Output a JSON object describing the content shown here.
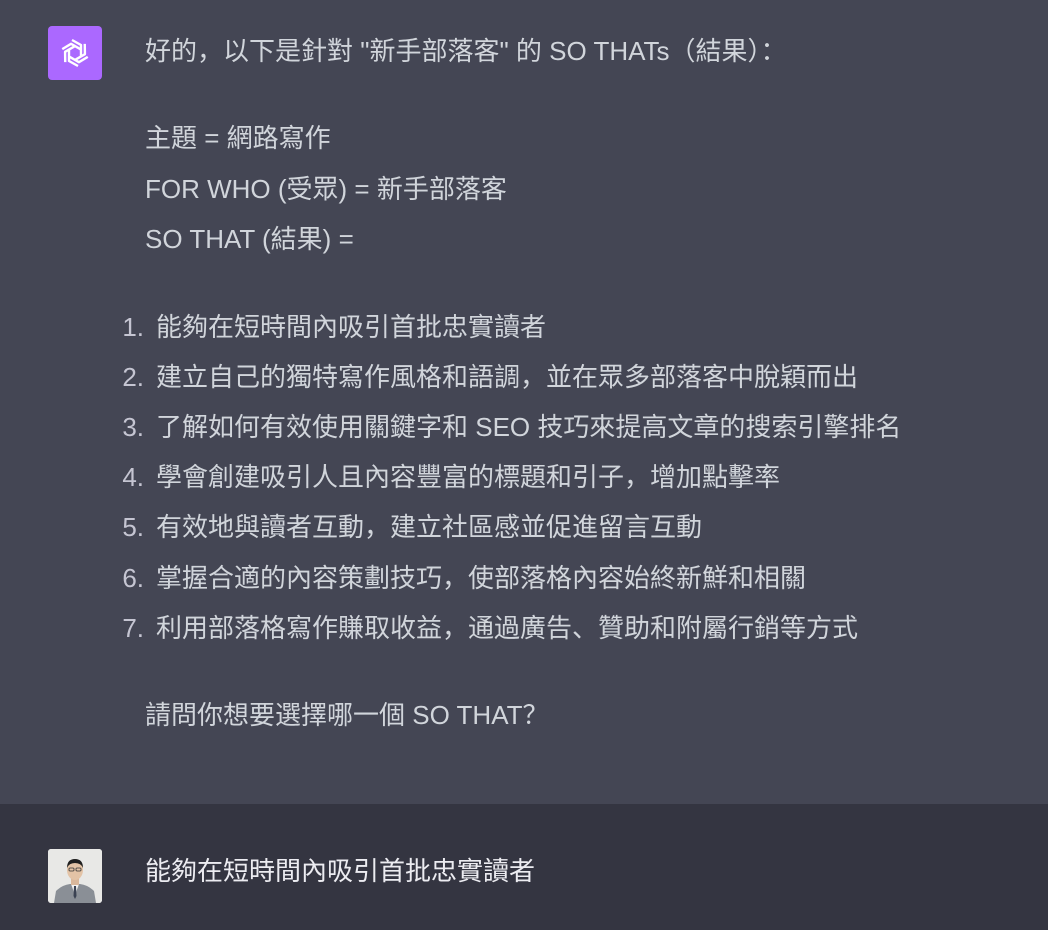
{
  "assistant": {
    "avatar_icon": "openai-logo-icon",
    "avatar_color": "#ab68ff",
    "intro": "好的，以下是針對 \"新手部落客\" 的 SO THATs（結果）：",
    "topic_line": "主題 = 網路寫作",
    "for_who_line": "FOR WHO (受眾) = 新手部落客",
    "so_that_line": "SO THAT (結果) =",
    "items": [
      {
        "num": "1.",
        "text": "能夠在短時間內吸引首批忠實讀者"
      },
      {
        "num": "2.",
        "text": "建立自己的獨特寫作風格和語調，並在眾多部落客中脫穎而出"
      },
      {
        "num": "3.",
        "text": "了解如何有效使用關鍵字和 SEO 技巧來提高文章的搜索引擎排名"
      },
      {
        "num": "4.",
        "text": "學會創建吸引人且內容豐富的標題和引子，增加點擊率"
      },
      {
        "num": "5.",
        "text": "有效地與讀者互動，建立社區感並促進留言互動"
      },
      {
        "num": "6.",
        "text": "掌握合適的內容策劃技巧，使部落格內容始終新鮮和相關"
      },
      {
        "num": "7.",
        "text": "利用部落格寫作賺取收益，通過廣告、贊助和附屬行銷等方式"
      }
    ],
    "question": "請問你想要選擇哪一個 SO THAT？"
  },
  "user": {
    "avatar_icon": "user-avatar-photo",
    "message": "能夠在短時間內吸引首批忠實讀者"
  },
  "colors": {
    "assistant_bg": "#444654",
    "user_bg": "#343541",
    "text": "#d1d5db"
  }
}
